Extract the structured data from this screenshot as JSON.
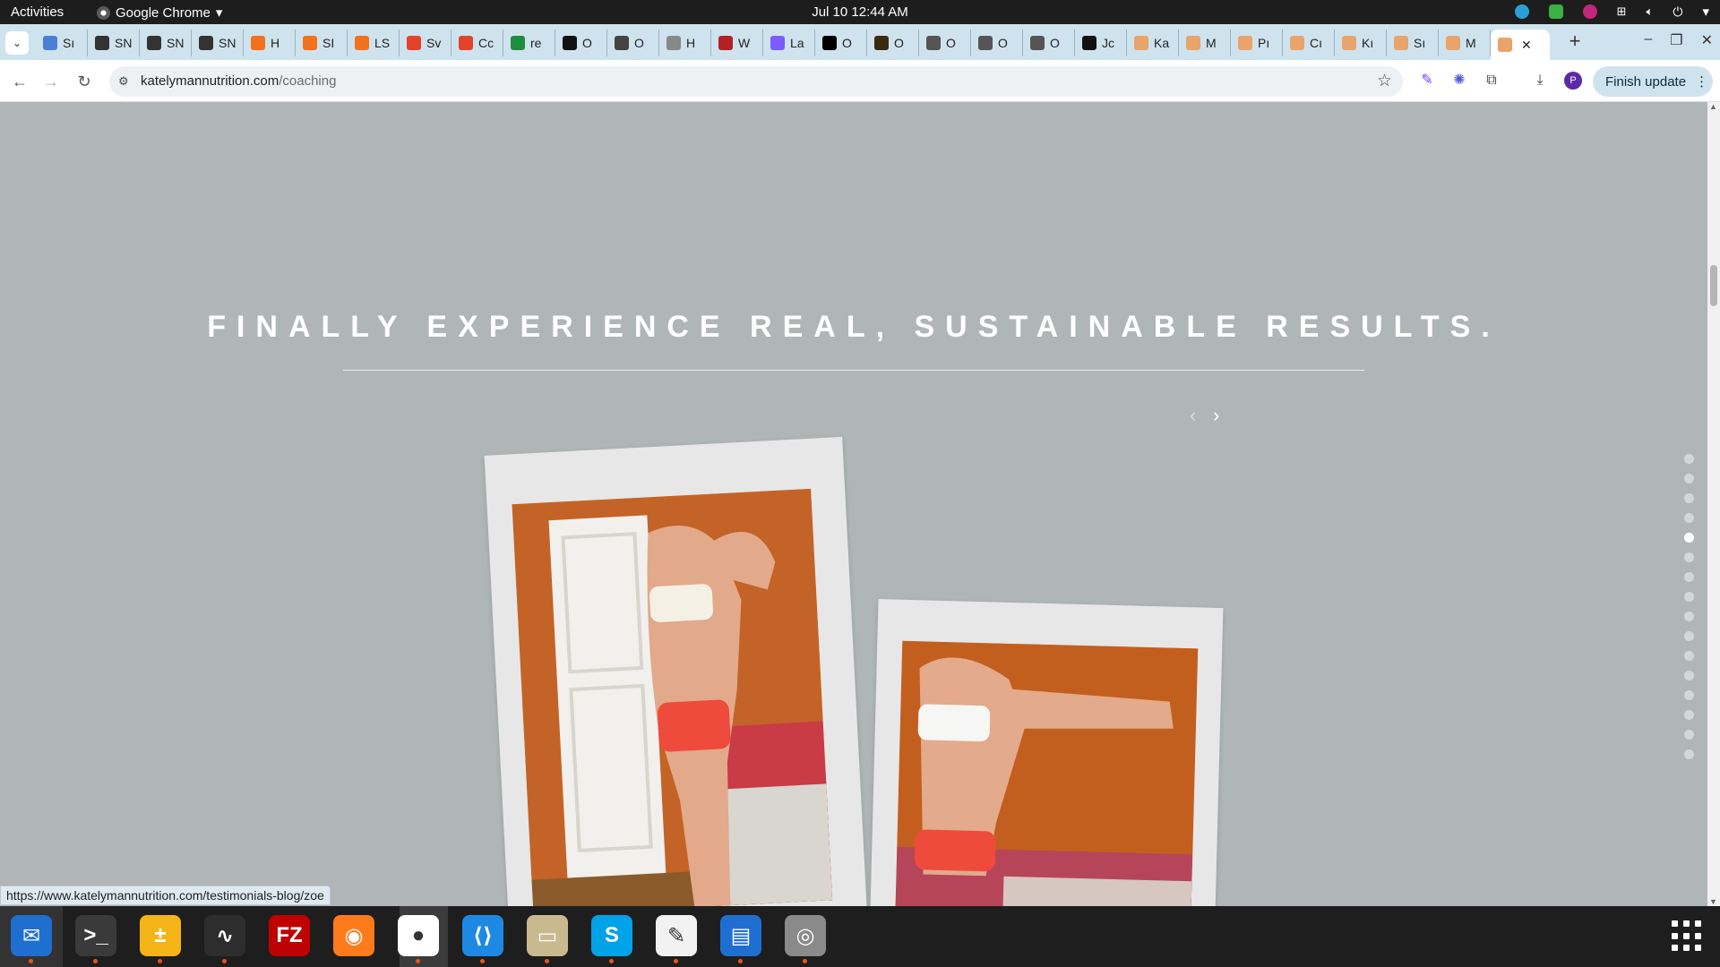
{
  "system_bar": {
    "activities": "Activities",
    "app_name": "Google Chrome",
    "clock": "Jul 10  12:44 AM"
  },
  "tabs": [
    {
      "label": "Sı",
      "icon": "docs-icon",
      "color": "#4a7fd6"
    },
    {
      "label": "SN",
      "icon": "snp-icon",
      "color": "#333333"
    },
    {
      "label": "SN",
      "icon": "snp-icon",
      "color": "#333333"
    },
    {
      "label": "SN",
      "icon": "snp-icon",
      "color": "#333333"
    },
    {
      "label": "H",
      "icon": "orange-circle-icon",
      "color": "#f2711c"
    },
    {
      "label": "SI",
      "icon": "orange-circle-icon",
      "color": "#f2711c"
    },
    {
      "label": "LS",
      "icon": "orange-circle-icon",
      "color": "#f2711c"
    },
    {
      "label": "Sv",
      "icon": "gitlab-icon",
      "color": "#e24329"
    },
    {
      "label": "Cc",
      "icon": "gitlab-icon",
      "color": "#e24329"
    },
    {
      "label": "re",
      "icon": "plus-green-icon",
      "color": "#1e8e3e"
    },
    {
      "label": "O",
      "icon": "openai-icon",
      "color": "#111111"
    },
    {
      "label": "O",
      "icon": "pin-icon",
      "color": "#444444"
    },
    {
      "label": "H",
      "icon": "globe-icon",
      "color": "#888888"
    },
    {
      "label": "W",
      "icon": "flag-icon",
      "color": "#b22222"
    },
    {
      "label": "La",
      "icon": "swirl-icon",
      "color": "#7a5cff"
    },
    {
      "label": "O",
      "icon": "black-square-icon",
      "color": "#000000"
    },
    {
      "label": "O",
      "icon": "dark-square-icon",
      "color": "#3a2a10"
    },
    {
      "label": "O",
      "icon": "people-icon",
      "color": "#555555"
    },
    {
      "label": "O",
      "icon": "mask-icon",
      "color": "#555555"
    },
    {
      "label": "O",
      "icon": "globe-icon",
      "color": "#555555"
    },
    {
      "label": "Jc",
      "icon": "circle-logo-icon",
      "color": "#111111"
    },
    {
      "label": "Ka",
      "icon": "peach-icon",
      "color": "#e8a46a"
    },
    {
      "label": "M",
      "icon": "peach-icon",
      "color": "#e8a46a"
    },
    {
      "label": "Pı",
      "icon": "peach-icon",
      "color": "#e8a46a"
    },
    {
      "label": "Cı",
      "icon": "peach-icon",
      "color": "#e8a46a"
    },
    {
      "label": "Kı",
      "icon": "peach-icon",
      "color": "#e8a46a"
    },
    {
      "label": "Sı",
      "icon": "peach-icon",
      "color": "#e8a46a"
    },
    {
      "label": "M",
      "icon": "peach-icon",
      "color": "#e8a46a"
    }
  ],
  "active_tab": {
    "icon": "peach-icon",
    "color": "#e8a46a"
  },
  "toolbar": {
    "url_domain": "katelymannutrition.com",
    "url_path": "/coaching",
    "finish_update": "Finish update",
    "profile_initial": "P"
  },
  "page": {
    "headline": "FINALLY EXPERIENCE REAL, SUSTAINABLE RESULTS.",
    "carousel_dots": 16,
    "active_dot_index": 4
  },
  "status_url": "https://www.katelymannutrition.com/testimonials-blog/zoe",
  "dock": [
    {
      "name": "thunderbird",
      "bg": "#1f6fd1",
      "glyph": "✉",
      "running": true
    },
    {
      "name": "terminal",
      "bg": "#3a3a3a",
      "glyph": ">_",
      "running": true
    },
    {
      "name": "calculator",
      "bg": "#f5b417",
      "glyph": "±",
      "running": true
    },
    {
      "name": "system-monitor",
      "bg": "#2d2d2d",
      "glyph": "∿",
      "running": true
    },
    {
      "name": "filezilla",
      "bg": "#bf0000",
      "glyph": "FZ",
      "running": false
    },
    {
      "name": "firefox",
      "bg": "#ff7a1a",
      "glyph": "◉",
      "running": false
    },
    {
      "name": "chrome",
      "bg": "#ffffff",
      "glyph": "●",
      "running": true
    },
    {
      "name": "vscode",
      "bg": "#1e88e5",
      "glyph": "⟨⟩",
      "running": true
    },
    {
      "name": "files",
      "bg": "#c9b98f",
      "glyph": "▭",
      "running": true
    },
    {
      "name": "skype",
      "bg": "#00a2e8",
      "glyph": "S",
      "running": true
    },
    {
      "name": "text-editor",
      "bg": "#f2f2f2",
      "glyph": "✎",
      "running": true
    },
    {
      "name": "libreoffice-writer",
      "bg": "#1f6fd1",
      "glyph": "▤",
      "running": true
    },
    {
      "name": "disks",
      "bg": "#8a8a8a",
      "glyph": "◎",
      "running": true
    }
  ]
}
